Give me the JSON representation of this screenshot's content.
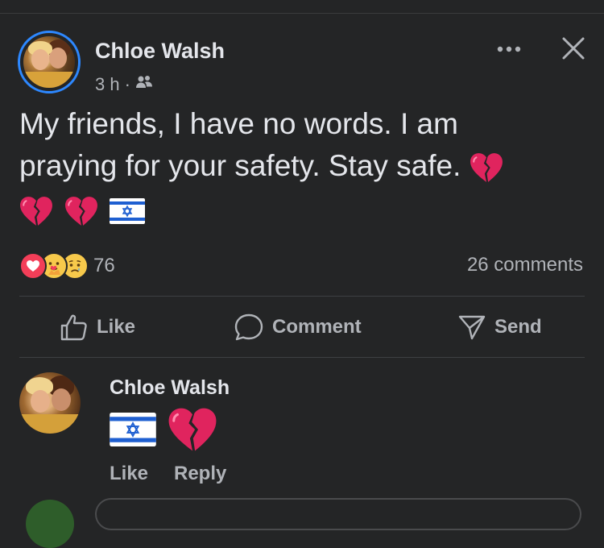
{
  "post": {
    "author": "Chloe Walsh",
    "time": "3 h",
    "separator": "·",
    "audience_icon": "friends-icon",
    "text_line1": "My friends, I have no words. I am",
    "text_line2": "praying for your safety. Stay safe.",
    "text_emojis": [
      "broken-heart-icon",
      "broken-heart-icon",
      "broken-heart-icon",
      "israel-flag-icon"
    ]
  },
  "reactions": {
    "icons": [
      "love-reaction-icon",
      "care-reaction-icon",
      "sad-reaction-icon"
    ],
    "count": "76",
    "comments": "26 comments"
  },
  "actions": {
    "like": "Like",
    "comment": "Comment",
    "send": "Send"
  },
  "comment": {
    "author": "Chloe Walsh",
    "emojis": [
      "israel-flag-icon",
      "broken-heart-icon"
    ],
    "like": "Like",
    "reply": "Reply"
  },
  "colors": {
    "background": "#242526",
    "text": "#e4e6eb",
    "secondary": "#b0b3b8",
    "accent": "#2d88ff",
    "heart": "#e0245e"
  }
}
